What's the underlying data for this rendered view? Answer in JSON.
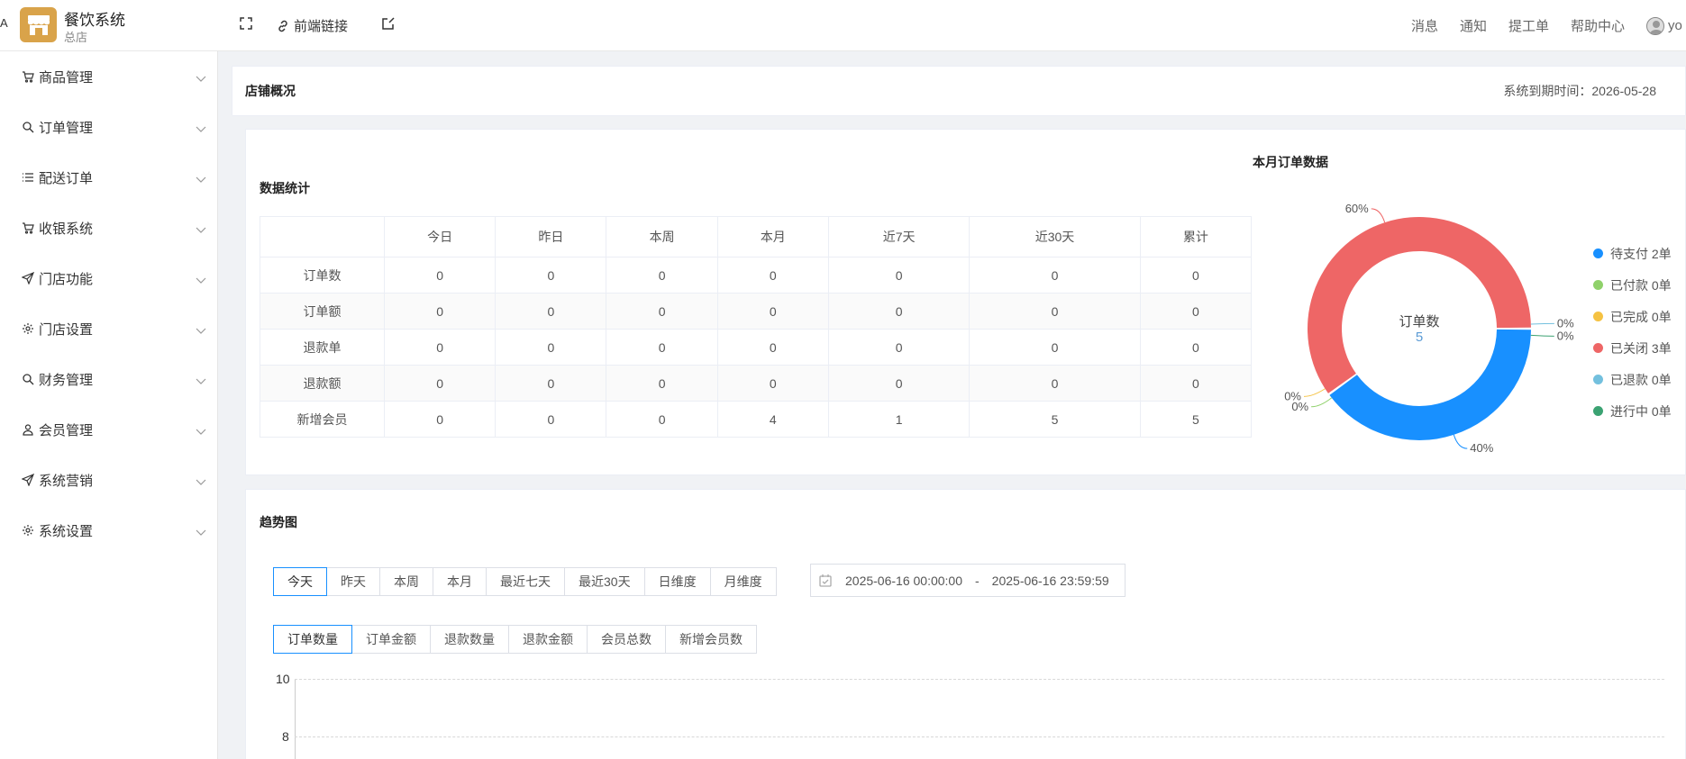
{
  "app": {
    "name": "餐饮系统",
    "store": "总店",
    "edge_glyph": "A"
  },
  "toolbar": {
    "fullscreen_icon": "expand-icon",
    "frontend_link_label": "前端链接",
    "edit_icon": "edit-icon"
  },
  "header_nav": {
    "items": [
      "消息",
      "通知",
      "提工单",
      "帮助中心"
    ],
    "user_text": "yo"
  },
  "sidebar": {
    "items": [
      {
        "label": "商品管理",
        "icon": "cart-icon"
      },
      {
        "label": "订单管理",
        "icon": "search-icon"
      },
      {
        "label": "配送订单",
        "icon": "list-icon"
      },
      {
        "label": "收银系统",
        "icon": "cart-icon"
      },
      {
        "label": "门店功能",
        "icon": "send-icon"
      },
      {
        "label": "门店设置",
        "icon": "gear-icon"
      },
      {
        "label": "财务管理",
        "icon": "search-icon"
      },
      {
        "label": "会员管理",
        "icon": "user-icon"
      },
      {
        "label": "系统营销",
        "icon": "send-icon"
      },
      {
        "label": "系统设置",
        "icon": "gear-icon"
      }
    ]
  },
  "overview": {
    "title": "店铺概况",
    "expire_text": "系统到期时间：2026-05-28"
  },
  "stats": {
    "title": "数据统计",
    "columns": [
      "今日",
      "昨日",
      "本周",
      "本月",
      "近7天",
      "近30天",
      "累计"
    ],
    "rows": [
      {
        "label": "订单数",
        "values": [
          "0",
          "0",
          "0",
          "0",
          "0",
          "0",
          "0"
        ]
      },
      {
        "label": "订单额",
        "values": [
          "0",
          "0",
          "0",
          "0",
          "0",
          "0",
          "0"
        ]
      },
      {
        "label": "退款单",
        "values": [
          "0",
          "0",
          "0",
          "0",
          "0",
          "0",
          "0"
        ]
      },
      {
        "label": "退款额",
        "values": [
          "0",
          "0",
          "0",
          "0",
          "0",
          "0",
          "0"
        ]
      },
      {
        "label": "新增会员",
        "values": [
          "0",
          "0",
          "0",
          "4",
          "1",
          "5",
          "5"
        ]
      }
    ]
  },
  "monthly_orders": {
    "title": "本月订单数据",
    "center_label": "订单数",
    "center_value": "5",
    "legend": [
      {
        "label": "待支付 2单",
        "color": "#1890ff"
      },
      {
        "label": "已付款 0单",
        "color": "#8fd16a"
      },
      {
        "label": "已完成 0单",
        "color": "#f5c242"
      },
      {
        "label": "已关闭 3单",
        "color": "#ee6666"
      },
      {
        "label": "已退款 0单",
        "color": "#73c0de"
      },
      {
        "label": "进行中 0单",
        "color": "#3ba272"
      }
    ]
  },
  "chart_data": {
    "type": "pie",
    "title": "本月订单数据",
    "categories": [
      "待支付",
      "已付款",
      "已完成",
      "已关闭",
      "已退款",
      "进行中"
    ],
    "values": [
      2,
      0,
      0,
      3,
      0,
      0
    ],
    "labels": [
      "40%",
      "0%",
      "0%",
      "60%",
      "0%",
      "0%"
    ],
    "colors": [
      "#1890ff",
      "#8fd16a",
      "#f5c242",
      "#ee6666",
      "#73c0de",
      "#3ba272"
    ],
    "legend": "right"
  },
  "trend": {
    "title": "趋势图",
    "period_buttons": [
      "今天",
      "昨天",
      "本周",
      "本月",
      "最近七天",
      "最近30天",
      "日维度",
      "月维度"
    ],
    "active_period": 0,
    "date_start": "2025-06-16 00:00:00",
    "date_sep": "-",
    "date_end": "2025-06-16 23:59:59",
    "metric_buttons": [
      "订单数量",
      "订单金额",
      "退款数量",
      "退款金额",
      "会员总数",
      "新增会员数"
    ],
    "active_metric": 0,
    "y_ticks": [
      "10",
      "8"
    ]
  }
}
